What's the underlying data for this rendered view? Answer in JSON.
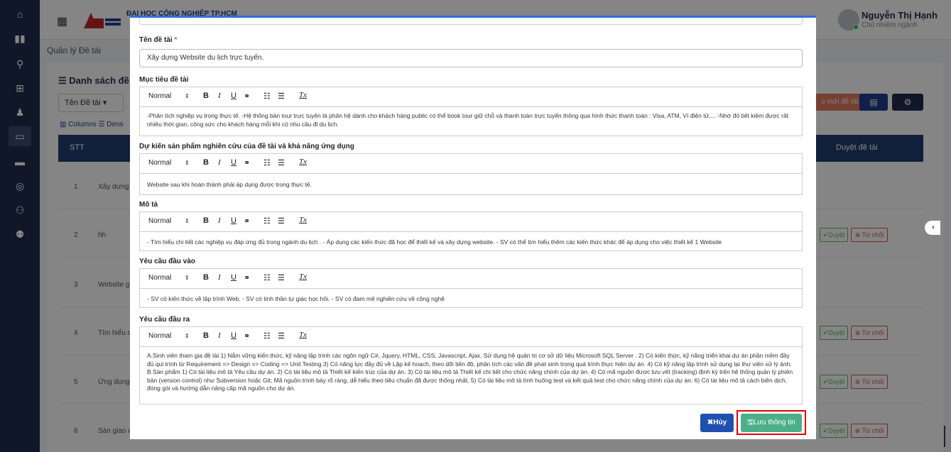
{
  "sidebar": {
    "icons": [
      "home-icon",
      "book-icon",
      "search-icon",
      "teacher-icon",
      "graduate-icon",
      "folder-icon",
      "monitor-icon",
      "chat-icon",
      "group-icon",
      "team-icon"
    ]
  },
  "header": {
    "org_name": "ĐẠI HỌC CÔNG NGHIỆP TP.HCM",
    "user_name": "Nguyễn Thị Hạnh",
    "user_role": "Chủ nhiệm ngành"
  },
  "page": {
    "title": "Quản lý Đề tài",
    "list_title": "Danh sách đề t",
    "filter_label": "Tên Đề tài",
    "columns_label": "Columns",
    "density_label": "Dens",
    "add_button": "o mới đề tài",
    "header_stt": "STT",
    "header_approve": "Duyệt đề tài",
    "approve_label": "Duyệt",
    "reject_label": "Từ chối",
    "rows": [
      {
        "num": "1",
        "name": "Xây dựng"
      },
      {
        "num": "2",
        "name": "hh"
      },
      {
        "num": "3",
        "name": "Website g"
      },
      {
        "num": "4",
        "name": "Tìm hiểu c"
      },
      {
        "num": "5",
        "name": "Ứng dụng"
      },
      {
        "num": "6",
        "name": "Sàn giao c"
      }
    ]
  },
  "modal": {
    "title_label": "Tên đề tài",
    "title_required": "*",
    "title_value": "Xây dựng Website du lịch trực tuyến.",
    "toolbar": {
      "format": "Normal",
      "arrow": "⇕",
      "bold": "B",
      "italic": "I",
      "underline": "U",
      "link": "🔗",
      "ordered_list": "☰",
      "bullet_list": "☰",
      "clear": "Tx"
    },
    "fields": [
      {
        "label": "Mục tiêu đề tài",
        "content": "-Phân tích nghiệp vụ trong thực tế. -Hệ thống bán tour trực tuyến là phân hệ dành cho khách hàng public có thể book tour giữ chỗ và thanh toán trực tuyến thông qua hình thức thanh toán : Visa, ATM, Ví điện tử,... -Nhờ đó tiết kiệm được rất nhiều thời gian, công sức cho khách hàng mỗi khi có nhu cầu đi du lịch."
      },
      {
        "label": "Dự kiến sản phẩm nghiên cứu của đề tài và khả năng ứng dụng",
        "content": "Website sau khi hoàn thành phải áp dụng được trong thực tế."
      },
      {
        "label": "Mô tả",
        "content": "- Tìm hiểu chi tiết các nghiệp vụ đáp ứng đủ trong ngành du lịch . - Áp dụng các kiến thức đã học để thiết kế và xây dựng website. - SV có thể tìm hiểu thêm các kiến thức khác để áp dụng cho việc thiết kế 1 Website"
      },
      {
        "label": "Yêu cầu đầu vào",
        "content": "- SV có kiến thức về lập trình Web. - SV có tinh thần tự giác học hỏi. - SV có đam mê nghiên cứu về công nghệ"
      },
      {
        "label": "Yêu cầu đầu ra",
        "content": "A.Sinh viên tham gia đề tài 1) Nắm vững kiến thức, kỹ năng lập trình các ngôn ngữ C#, Jquery, HTML, CSS, Javascript, Ajax. Sử dụng hệ quản trị cơ sở dữ liệu Microsoft SQL Server . 2) Có kiến thức, kỹ năng triển khai dự án phần mềm đầy đủ qui trình từ Requirement => Design => Coding => Unit Testing 3) Có năng lực đầy đủ về Lập kế hoạch, theo dõi tiến độ, phân tích các vấn đề phát sinh trong quá trình thực hiện dự án. 4) Có kỹ năng lập trình sử dụng lại thư viện xử lý ảnh. B.Sản phẩm 1) Có tài liệu mô tả Yêu cầu dự án. 2) Có tài liệu mô tả Thiết kế kiến trúc của dự án. 3) Có tài liệu mô tả Thiết kế chi tiết cho chức năng chính của dự án. 4) Có mã nguồn được lưu vết (tracking) định kỳ trên hệ thống quản lý phiên bản (version control) như Subversion hoặc Git; Mã nguồn trình bày rõ ràng, dễ hiểu theo tiêu chuẩn đã được thống nhất. 5) Có tài liệu mô tả tình huống test và kết quả test cho chức năng chính của dự án. 6) Có tài liệu mô tả cách biên dịch, đóng gói và hướng dẫn nâng cấp mã nguồn cho dự án."
      }
    ],
    "cancel_label": "Hủy",
    "save_label": "Lưu thông tin"
  }
}
